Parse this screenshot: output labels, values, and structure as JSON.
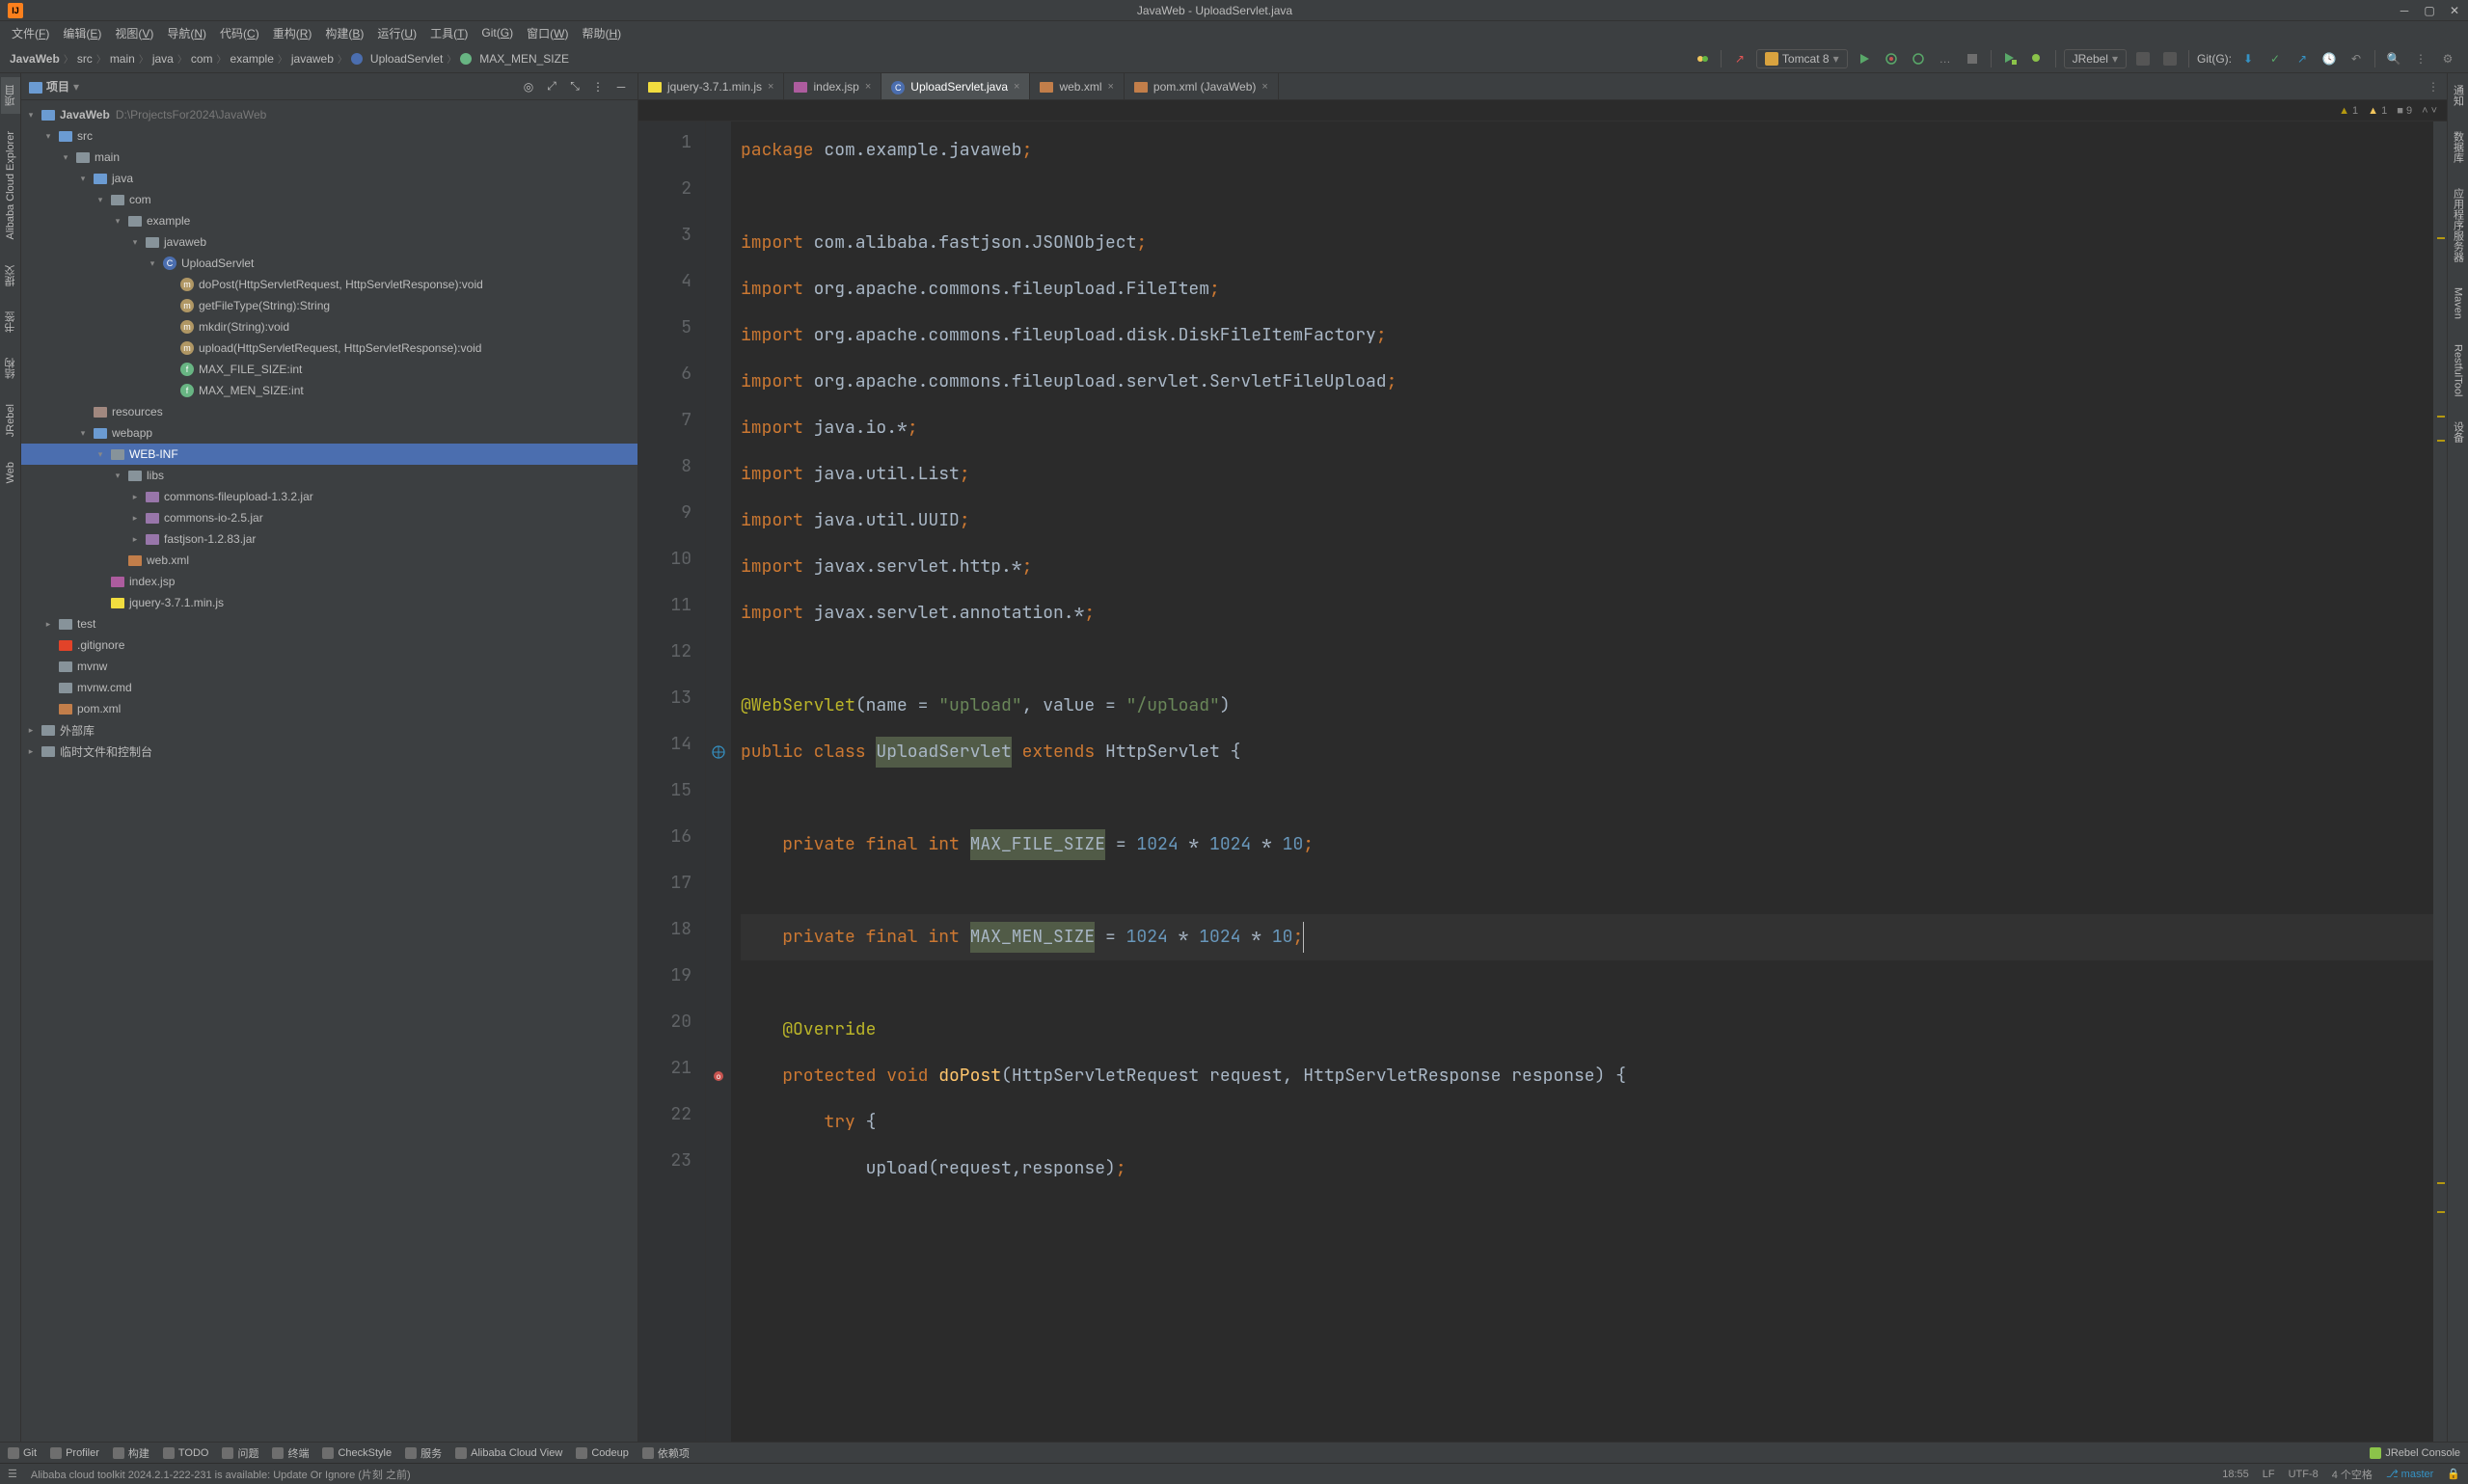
{
  "window": {
    "title": "JavaWeb - UploadServlet.java"
  },
  "menubar": [
    {
      "label": "文件",
      "u": "F"
    },
    {
      "label": "编辑",
      "u": "E"
    },
    {
      "label": "视图",
      "u": "V"
    },
    {
      "label": "导航",
      "u": "N"
    },
    {
      "label": "代码",
      "u": "C"
    },
    {
      "label": "重构",
      "u": "R"
    },
    {
      "label": "构建",
      "u": "B"
    },
    {
      "label": "运行",
      "u": "U"
    },
    {
      "label": "工具",
      "u": "T"
    },
    {
      "label": "Git",
      "u": "G"
    },
    {
      "label": "窗口",
      "u": "W"
    },
    {
      "label": "帮助",
      "u": "H"
    }
  ],
  "breadcrumb": [
    "JavaWeb",
    "src",
    "main",
    "java",
    "com",
    "example",
    "javaweb",
    "UploadServlet",
    "MAX_MEN_SIZE"
  ],
  "runconfig": "Tomcat 8",
  "git_label": "Git(G):",
  "project_panel": {
    "title": "项目",
    "root": {
      "label": "JavaWeb",
      "hint": "D:\\ProjectsFor2024\\JavaWeb"
    },
    "tree": [
      {
        "d": 1,
        "name": "src",
        "icon": "folder-blue",
        "open": true,
        "arrow": "v"
      },
      {
        "d": 2,
        "name": "main",
        "icon": "folder",
        "open": true,
        "arrow": "v"
      },
      {
        "d": 3,
        "name": "java",
        "icon": "folder-blue",
        "open": true,
        "arrow": "v"
      },
      {
        "d": 4,
        "name": "com",
        "icon": "package",
        "open": true,
        "arrow": "v"
      },
      {
        "d": 5,
        "name": "example",
        "icon": "package",
        "open": true,
        "arrow": "v"
      },
      {
        "d": 6,
        "name": "javaweb",
        "icon": "package",
        "open": true,
        "arrow": "v"
      },
      {
        "d": 7,
        "name": "UploadServlet",
        "icon": "class",
        "open": true,
        "arrow": "v"
      },
      {
        "d": 8,
        "name": "doPost(HttpServletRequest, HttpServletResponse):void",
        "icon": "method"
      },
      {
        "d": 8,
        "name": "getFileType(String):String",
        "icon": "method"
      },
      {
        "d": 8,
        "name": "mkdir(String):void",
        "icon": "method"
      },
      {
        "d": 8,
        "name": "upload(HttpServletRequest, HttpServletResponse):void",
        "icon": "method"
      },
      {
        "d": 8,
        "name": "MAX_FILE_SIZE:int",
        "icon": "field"
      },
      {
        "d": 8,
        "name": "MAX_MEN_SIZE:int",
        "icon": "field"
      },
      {
        "d": 3,
        "name": "resources",
        "icon": "folder-res",
        "arrow": ""
      },
      {
        "d": 3,
        "name": "webapp",
        "icon": "folder-blue",
        "open": true,
        "arrow": "v"
      },
      {
        "d": 4,
        "name": "WEB-INF",
        "icon": "folder",
        "open": true,
        "arrow": "v",
        "selected": true
      },
      {
        "d": 5,
        "name": "libs",
        "icon": "folder",
        "open": true,
        "arrow": "v"
      },
      {
        "d": 6,
        "name": "commons-fileupload-1.3.2.jar",
        "icon": "jar",
        "arrow": ">"
      },
      {
        "d": 6,
        "name": "commons-io-2.5.jar",
        "icon": "jar",
        "arrow": ">"
      },
      {
        "d": 6,
        "name": "fastjson-1.2.83.jar",
        "icon": "jar",
        "arrow": ">"
      },
      {
        "d": 5,
        "name": "web.xml",
        "icon": "xml"
      },
      {
        "d": 4,
        "name": "index.jsp",
        "icon": "jsp"
      },
      {
        "d": 4,
        "name": "jquery-3.7.1.min.js",
        "icon": "js"
      },
      {
        "d": 1,
        "name": "test",
        "icon": "folder",
        "arrow": ">"
      },
      {
        "d": 1,
        "name": ".gitignore",
        "icon": "git"
      },
      {
        "d": 1,
        "name": "mvnw",
        "icon": "file"
      },
      {
        "d": 1,
        "name": "mvnw.cmd",
        "icon": "file"
      },
      {
        "d": 1,
        "name": "pom.xml",
        "icon": "xml-maven"
      }
    ],
    "extra": [
      "外部库",
      "临时文件和控制台"
    ]
  },
  "editor_tabs": [
    {
      "label": "jquery-3.7.1.min.js",
      "icon": "js"
    },
    {
      "label": "index.jsp",
      "icon": "jsp"
    },
    {
      "label": "UploadServlet.java",
      "icon": "class",
      "active": true
    },
    {
      "label": "web.xml",
      "icon": "xml"
    },
    {
      "label": "pom.xml (JavaWeb)",
      "icon": "xml-maven"
    }
  ],
  "inspections": {
    "warn1_count": "1",
    "warn2_count": "1",
    "info_count": "9"
  },
  "code_lines": [
    {
      "n": 1,
      "tokens": [
        [
          "kw",
          "package"
        ],
        [
          "txt",
          " com.example.javaweb"
        ],
        [
          "semi",
          ";"
        ]
      ]
    },
    {
      "n": 2,
      "tokens": []
    },
    {
      "n": 3,
      "tokens": [
        [
          "kw",
          "import"
        ],
        [
          "txt",
          " com.alibaba.fastjson.JSONObject"
        ],
        [
          "semi",
          ";"
        ]
      ]
    },
    {
      "n": 4,
      "tokens": [
        [
          "kw",
          "import"
        ],
        [
          "txt",
          " org.apache.commons.fileupload.FileItem"
        ],
        [
          "semi",
          ";"
        ]
      ]
    },
    {
      "n": 5,
      "tokens": [
        [
          "kw",
          "import"
        ],
        [
          "txt",
          " org.apache.commons.fileupload.disk.DiskFileItemFactory"
        ],
        [
          "semi",
          ";"
        ]
      ]
    },
    {
      "n": 6,
      "tokens": [
        [
          "kw",
          "import"
        ],
        [
          "txt",
          " org.apache.commons.fileupload.servlet.ServletFileUpload"
        ],
        [
          "semi",
          ";"
        ]
      ]
    },
    {
      "n": 7,
      "tokens": [
        [
          "kw",
          "import"
        ],
        [
          "txt",
          " java.io.*"
        ],
        [
          "semi",
          ";"
        ]
      ]
    },
    {
      "n": 8,
      "tokens": [
        [
          "kw",
          "import"
        ],
        [
          "txt",
          " java.util.List"
        ],
        [
          "semi",
          ";"
        ]
      ]
    },
    {
      "n": 9,
      "tokens": [
        [
          "kw",
          "import"
        ],
        [
          "txt",
          " java.util.UUID"
        ],
        [
          "semi",
          ";"
        ]
      ]
    },
    {
      "n": 10,
      "tokens": [
        [
          "kw",
          "import"
        ],
        [
          "txt",
          " javax.servlet.http.*"
        ],
        [
          "semi",
          ";"
        ]
      ]
    },
    {
      "n": 11,
      "tokens": [
        [
          "kw",
          "import"
        ],
        [
          "txt",
          " javax.servlet.annotation.*"
        ],
        [
          "semi",
          ";"
        ]
      ]
    },
    {
      "n": 12,
      "tokens": []
    },
    {
      "n": 13,
      "tokens": [
        [
          "ann",
          "@WebServlet"
        ],
        [
          "txt",
          "(name = "
        ],
        [
          "str",
          "\"upload\""
        ],
        [
          "txt",
          ", value = "
        ],
        [
          "str",
          "\"/upload\""
        ],
        [
          "txt",
          ")"
        ]
      ]
    },
    {
      "n": 14,
      "tokens": [
        [
          "kw",
          "public class "
        ],
        [
          "hl",
          "UploadServlet"
        ],
        [
          "kw",
          " extends"
        ],
        [
          "txt",
          " HttpServlet "
        ],
        [
          "txt",
          "{"
        ]
      ],
      "gi": "web"
    },
    {
      "n": 15,
      "tokens": []
    },
    {
      "n": 16,
      "tokens": [
        [
          "txt",
          "    "
        ],
        [
          "kw",
          "private final int "
        ],
        [
          "hl",
          "MAX_FILE_SIZE"
        ],
        [
          "txt",
          " = "
        ],
        [
          "num",
          "1024"
        ],
        [
          "txt",
          " * "
        ],
        [
          "num",
          "1024"
        ],
        [
          "txt",
          " * "
        ],
        [
          "num",
          "10"
        ],
        [
          "semi",
          ";"
        ]
      ]
    },
    {
      "n": 17,
      "tokens": []
    },
    {
      "n": 18,
      "tokens": [
        [
          "txt",
          "    "
        ],
        [
          "kw",
          "private final int "
        ],
        [
          "hl",
          "MAX_MEN_SIZE"
        ],
        [
          "txt",
          " = "
        ],
        [
          "num",
          "1024"
        ],
        [
          "txt",
          " * "
        ],
        [
          "num",
          "1024"
        ],
        [
          "txt",
          " * "
        ],
        [
          "num",
          "10"
        ],
        [
          "semi",
          ";"
        ],
        [
          "cursor",
          ""
        ]
      ],
      "current": true
    },
    {
      "n": 19,
      "tokens": []
    },
    {
      "n": 20,
      "tokens": [
        [
          "txt",
          "    "
        ],
        [
          "ann",
          "@Override"
        ]
      ]
    },
    {
      "n": 21,
      "tokens": [
        [
          "txt",
          "    "
        ],
        [
          "kw",
          "protected void "
        ],
        [
          "fn",
          "doPost"
        ],
        [
          "txt",
          "(HttpServletRequest request, HttpServletResponse response) {"
        ]
      ],
      "gi": "override"
    },
    {
      "n": 22,
      "tokens": [
        [
          "txt",
          "        "
        ],
        [
          "kw",
          "try"
        ],
        [
          "txt",
          " {"
        ]
      ]
    },
    {
      "n": 23,
      "tokens": [
        [
          "txt",
          "            upload(request,response)"
        ],
        [
          "semi",
          ";"
        ]
      ]
    }
  ],
  "left_tabs": [
    "项目",
    "Alibaba Cloud Explorer",
    "提交",
    "书签",
    "结构",
    "JRebel",
    "Web"
  ],
  "right_tabs": [
    "通知",
    "数据库",
    "应用程序服务器",
    "Maven",
    "RestfulTool",
    "设备"
  ],
  "bottom_tools": [
    {
      "label": "Git",
      "icon": "git"
    },
    {
      "label": "Profiler",
      "icon": "profiler"
    },
    {
      "label": "构建",
      "icon": "build"
    },
    {
      "label": "TODO",
      "icon": "todo"
    },
    {
      "label": "问题",
      "icon": "problems"
    },
    {
      "label": "终端",
      "icon": "terminal"
    },
    {
      "label": "CheckStyle",
      "icon": "check"
    },
    {
      "label": "服务",
      "icon": "services"
    },
    {
      "label": "Alibaba Cloud View",
      "icon": "cloud"
    },
    {
      "label": "Codeup",
      "icon": "codeup"
    },
    {
      "label": "依赖项",
      "icon": "deps"
    }
  ],
  "bottom_right": {
    "label": "JRebel Console"
  },
  "status": {
    "message": "Alibaba cloud toolkit 2024.2.1-222-231 is available: Update Or Ignore (片刻 之前)",
    "pos": "18:55",
    "lf": "LF",
    "enc": "UTF-8",
    "indent": "4 个空格",
    "branch": "master"
  }
}
